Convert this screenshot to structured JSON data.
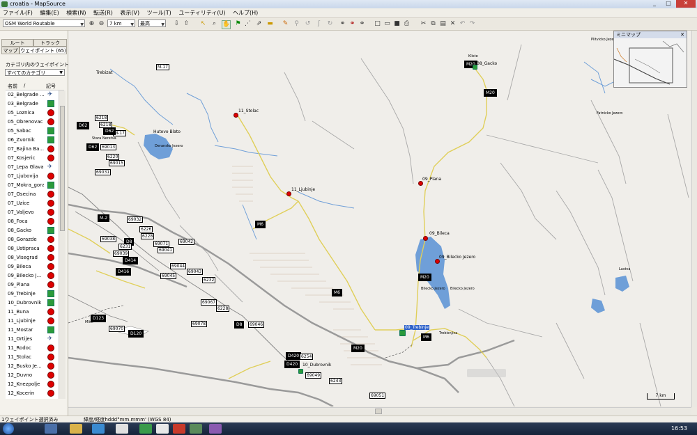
{
  "window": {
    "title": "croatia - MapSource",
    "controls": [
      "_",
      "□",
      "✕"
    ]
  },
  "menu": [
    "ファイル(F)",
    "編集(E)",
    "検索(N)",
    "転送(R)",
    "表示(V)",
    "ツール(T)",
    "ユーティリティ(U)",
    "ヘルプ(H)"
  ],
  "toolbar": {
    "map_product": "OSM World Routable",
    "zoom": "7 km",
    "detail": "最高"
  },
  "left_panel": {
    "tabs_top": [
      "ルート",
      "トラック"
    ],
    "tabs_bottom": [
      "マップ",
      "ウェイポイント (65)"
    ],
    "category_label": "カテゴリ内のウェイポイントを表",
    "category_value": "すべてのカテゴリ",
    "col_name": "名前",
    "col_sort": "/",
    "col_symbol": "記号",
    "waypoints": [
      {
        "name": "02_Belgrade ...",
        "sym": "plane"
      },
      {
        "name": "03_Belgrade",
        "sym": "flag"
      },
      {
        "name": "05_Loznica",
        "sym": "pin"
      },
      {
        "name": "05_Obrenovac",
        "sym": "pin"
      },
      {
        "name": "05_Sabac",
        "sym": "flag"
      },
      {
        "name": "06_Zvornik",
        "sym": "flag"
      },
      {
        "name": "07_Bajina Ba...",
        "sym": "pin"
      },
      {
        "name": "07_Kosjeric",
        "sym": "pin"
      },
      {
        "name": "07_Lepa Glava",
        "sym": "plane"
      },
      {
        "name": "07_Ljubovija",
        "sym": "pin"
      },
      {
        "name": "07_Mokra_gora",
        "sym": "flag"
      },
      {
        "name": "07_Osecina",
        "sym": "pin"
      },
      {
        "name": "07_Uzice",
        "sym": "pin"
      },
      {
        "name": "07_Valjevo",
        "sym": "pin"
      },
      {
        "name": "08_Foca",
        "sym": "pin"
      },
      {
        "name": "08_Gacko",
        "sym": "flag"
      },
      {
        "name": "08_Gorazde",
        "sym": "pin"
      },
      {
        "name": "08_Ustipraca",
        "sym": "pin"
      },
      {
        "name": "08_Visegrad",
        "sym": "pin"
      },
      {
        "name": "09_Bileca",
        "sym": "pin"
      },
      {
        "name": "09_Bilecko J...",
        "sym": "pin"
      },
      {
        "name": "09_Plana",
        "sym": "pin"
      },
      {
        "name": "09_Trebinje",
        "sym": "flag"
      },
      {
        "name": "10_Dubrovnik",
        "sym": "flag"
      },
      {
        "name": "11_Buna",
        "sym": "pin"
      },
      {
        "name": "11_Ljubinje",
        "sym": "pin"
      },
      {
        "name": "11_Mostar",
        "sym": "flag"
      },
      {
        "name": "11_Ortijes",
        "sym": "plane"
      },
      {
        "name": "11_Rodoc",
        "sym": "pin"
      },
      {
        "name": "11_Stolac",
        "sym": "pin"
      },
      {
        "name": "12_Busko Je...",
        "sym": "pin"
      },
      {
        "name": "12_Duvno",
        "sym": "pin"
      },
      {
        "name": "12_Knezpolje",
        "sym": "pin"
      },
      {
        "name": "12_Kocerin",
        "sym": "pin"
      }
    ]
  },
  "map": {
    "minimap_title": "ミニマップ",
    "scale": "7 km",
    "road_labels": [
      "M-17",
      "M-17",
      "D62",
      "D62",
      "6218",
      "6218",
      "D62",
      "69013",
      "6220",
      "69015",
      "69031",
      "M-2",
      "69032",
      "6226",
      "6228",
      "69038",
      "D8",
      "6231",
      "69039",
      "69071",
      "69041",
      "69042",
      "D414",
      "D416",
      "69044",
      "69043",
      "69045",
      "6232",
      "69067",
      "6228",
      "D123",
      "69070",
      "D120",
      "69078",
      "D8",
      "69046",
      "D420",
      "6254",
      "D420",
      "69049",
      "6243",
      "69051",
      "M6",
      "M6",
      "M20",
      "M20",
      "M20",
      "M6",
      "M20"
    ],
    "towns": [
      "Trebizat",
      "Hutovo Blato",
      "Deransko Jezero",
      "Stara Neretva",
      "11_Stolac",
      "11_Ljubinje",
      "08_Gacko",
      "Kliste",
      "09_Plana",
      "09_Bileca",
      "09_Bilecko Jezero",
      "Bilecko Jezero",
      "Bilecko Jezero",
      "09_Trebinje",
      "10_Dubrovnik",
      "Trebisnjica",
      "Mlini",
      "Plitvicko Jezero",
      "Fatnicko Jezero",
      "Lastva"
    ]
  },
  "status": {
    "left": "1ウェイポイント選択済み",
    "right": "緯度/経度hddd°mm.mmm' (WGS 84)"
  },
  "taskbar": {
    "clock": "16:53"
  }
}
